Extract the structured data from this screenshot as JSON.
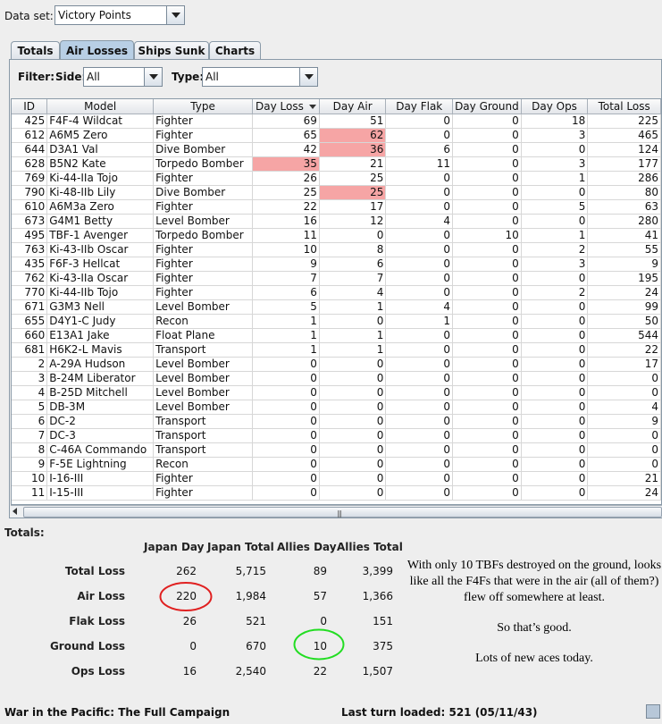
{
  "dataset": {
    "label": "Data set:",
    "value": "Victory Points"
  },
  "tabs": [
    "Totals",
    "Air Losses",
    "Ships Sunk",
    "Charts"
  ],
  "filter": {
    "label": "Filter:",
    "side_label": "Side:",
    "side_value": "All",
    "type_label": "Type:",
    "type_value": "All"
  },
  "columns": [
    "ID",
    "Model",
    "Type",
    "Day Loss",
    "Day Air",
    "Day Flak",
    "Day Ground",
    "Day Ops",
    "Total Loss"
  ],
  "rows": [
    [
      "425",
      "F4F-4 Wildcat",
      "Fighter",
      "69",
      "51",
      "0",
      "0",
      "18",
      "225"
    ],
    [
      "612",
      "A6M5 Zero",
      "Fighter",
      "65",
      "62",
      "0",
      "0",
      "3",
      "465"
    ],
    [
      "644",
      "D3A1 Val",
      "Dive Bomber",
      "42",
      "36",
      "6",
      "0",
      "0",
      "124"
    ],
    [
      "628",
      "B5N2 Kate",
      "Torpedo Bomber",
      "35",
      "21",
      "11",
      "0",
      "3",
      "177"
    ],
    [
      "769",
      "Ki-44-IIa Tojo",
      "Fighter",
      "26",
      "25",
      "0",
      "0",
      "1",
      "286"
    ],
    [
      "790",
      "Ki-48-IIb Lily",
      "Dive Bomber",
      "25",
      "25",
      "0",
      "0",
      "0",
      "80"
    ],
    [
      "610",
      "A6M3a Zero",
      "Fighter",
      "22",
      "17",
      "0",
      "0",
      "5",
      "63"
    ],
    [
      "673",
      "G4M1 Betty",
      "Level Bomber",
      "16",
      "12",
      "4",
      "0",
      "0",
      "280"
    ],
    [
      "495",
      "TBF-1 Avenger",
      "Torpedo Bomber",
      "11",
      "0",
      "0",
      "10",
      "1",
      "41"
    ],
    [
      "763",
      "Ki-43-IIb Oscar",
      "Fighter",
      "10",
      "8",
      "0",
      "0",
      "2",
      "55"
    ],
    [
      "435",
      "F6F-3 Hellcat",
      "Fighter",
      "9",
      "6",
      "0",
      "0",
      "3",
      "9"
    ],
    [
      "762",
      "Ki-43-IIa Oscar",
      "Fighter",
      "7",
      "7",
      "0",
      "0",
      "0",
      "195"
    ],
    [
      "770",
      "Ki-44-IIb Tojo",
      "Fighter",
      "6",
      "4",
      "0",
      "0",
      "2",
      "24"
    ],
    [
      "671",
      "G3M3 Nell",
      "Level Bomber",
      "5",
      "1",
      "4",
      "0",
      "0",
      "99"
    ],
    [
      "655",
      "D4Y1-C Judy",
      "Recon",
      "1",
      "0",
      "1",
      "0",
      "0",
      "50"
    ],
    [
      "660",
      "E13A1 Jake",
      "Float Plane",
      "1",
      "1",
      "0",
      "0",
      "0",
      "544"
    ],
    [
      "681",
      "H6K2-L Mavis",
      "Transport",
      "1",
      "1",
      "0",
      "0",
      "0",
      "22"
    ],
    [
      "2",
      "A-29A Hudson",
      "Level Bomber",
      "0",
      "0",
      "0",
      "0",
      "0",
      "17"
    ],
    [
      "3",
      "B-24M Liberator",
      "Level Bomber",
      "0",
      "0",
      "0",
      "0",
      "0",
      "0"
    ],
    [
      "4",
      "B-25D Mitchell",
      "Level Bomber",
      "0",
      "0",
      "0",
      "0",
      "0",
      "0"
    ],
    [
      "5",
      "DB-3M",
      "Level Bomber",
      "0",
      "0",
      "0",
      "0",
      "0",
      "4"
    ],
    [
      "6",
      "DC-2",
      "Transport",
      "0",
      "0",
      "0",
      "0",
      "0",
      "9"
    ],
    [
      "7",
      "DC-3",
      "Transport",
      "0",
      "0",
      "0",
      "0",
      "0",
      "0"
    ],
    [
      "8",
      "C-46A Commando",
      "Transport",
      "0",
      "0",
      "0",
      "0",
      "0",
      "0"
    ],
    [
      "9",
      "F-5E Lightning",
      "Recon",
      "0",
      "0",
      "0",
      "0",
      "0",
      "0"
    ],
    [
      "10",
      "I-16-III",
      "Fighter",
      "0",
      "0",
      "0",
      "0",
      "0",
      "21"
    ],
    [
      "11",
      "I-15-III",
      "Fighter",
      "0",
      "0",
      "0",
      "0",
      "0",
      "24"
    ]
  ],
  "highlight_color": "#f6a5a5",
  "totals": {
    "title": "Totals:",
    "headers": [
      "Japan Day",
      "Japan Total",
      "Allies Day",
      "Allies Total"
    ],
    "rows": [
      {
        "label": "Total Loss",
        "values": [
          "262",
          "5,715",
          "89",
          "3,399"
        ]
      },
      {
        "label": "Air Loss",
        "values": [
          "220",
          "1,984",
          "57",
          "1,366"
        ]
      },
      {
        "label": "Flak Loss",
        "values": [
          "26",
          "521",
          "0",
          "151"
        ]
      },
      {
        "label": "Ground Loss",
        "values": [
          "0",
          "670",
          "10",
          "375"
        ]
      },
      {
        "label": "Ops Loss",
        "values": [
          "16",
          "2,540",
          "22",
          "1,507"
        ]
      }
    ]
  },
  "annotation": {
    "line1": "With only 10 TBFs destroyed on the ground, looks like all the F4Fs that were in the air (all of them?) flew off somewhere at least.",
    "line2": "So that’s good.",
    "line3": "Lots of new aces today.",
    "red_circle_color": "#e02020",
    "green_circle_color": "#22dd22"
  },
  "status": {
    "app": "War in the Pacific: The Full Campaign",
    "turn": "Last turn loaded: 521 (05/11/43)"
  }
}
